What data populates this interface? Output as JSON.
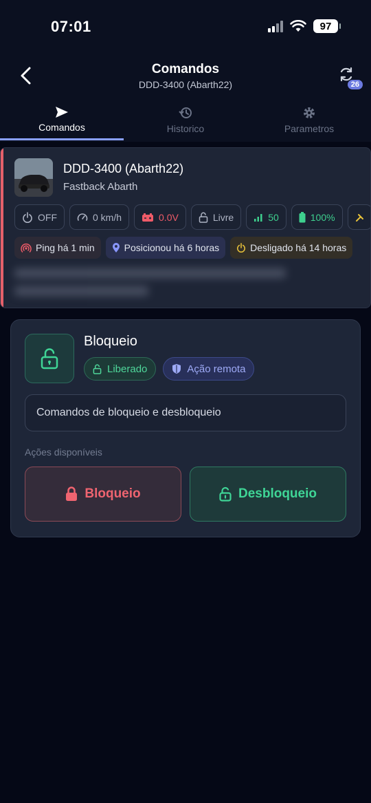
{
  "status_bar": {
    "time": "07:01",
    "battery": "97"
  },
  "header": {
    "title": "Comandos",
    "subtitle": "DDD-3400 (Abarth22)",
    "refresh_badge": "26"
  },
  "tabs": [
    {
      "label": "Comandos",
      "icon": "send-icon",
      "active": true
    },
    {
      "label": "Historico",
      "icon": "history-icon",
      "active": false
    },
    {
      "label": "Parametros",
      "icon": "gear-icon",
      "active": false
    }
  ],
  "vehicle": {
    "name": "DDD-3400 (Abarth22)",
    "model": "Fastback Abarth",
    "chips": [
      {
        "label": "OFF",
        "icon": "power-icon",
        "color": "#aeb4c4"
      },
      {
        "label": "0 km/h",
        "icon": "speedometer-icon",
        "color": "#aeb4c4"
      },
      {
        "label": "0.0V",
        "icon": "car-battery-icon",
        "color": "#ef5b68"
      },
      {
        "label": "Livre",
        "icon": "lock-open-icon",
        "color": "#aeb4c4"
      },
      {
        "label": "50",
        "icon": "signal-bars-icon",
        "color": "#3ecf8e"
      },
      {
        "label": "100%",
        "icon": "battery-icon",
        "color": "#3ecf8e"
      }
    ],
    "tags": [
      {
        "label": "Ping há 1 min",
        "icon": "ping-icon",
        "color": "#ef5b68"
      },
      {
        "label": "Posicionou há 6 horas",
        "icon": "location-pin-icon",
        "color": "#8a97ff"
      },
      {
        "label": "Desligado há 14 horas",
        "icon": "power-icon",
        "color": "#e8c23a"
      }
    ]
  },
  "command": {
    "title": "Bloqueio",
    "status_tag": "Liberado",
    "mode_tag": "Ação remota",
    "description": "Comandos de bloqueio e desbloqueio",
    "actions_label": "Ações disponíveis",
    "lock_button": "Bloqueio",
    "unlock_button": "Desbloqueio"
  }
}
